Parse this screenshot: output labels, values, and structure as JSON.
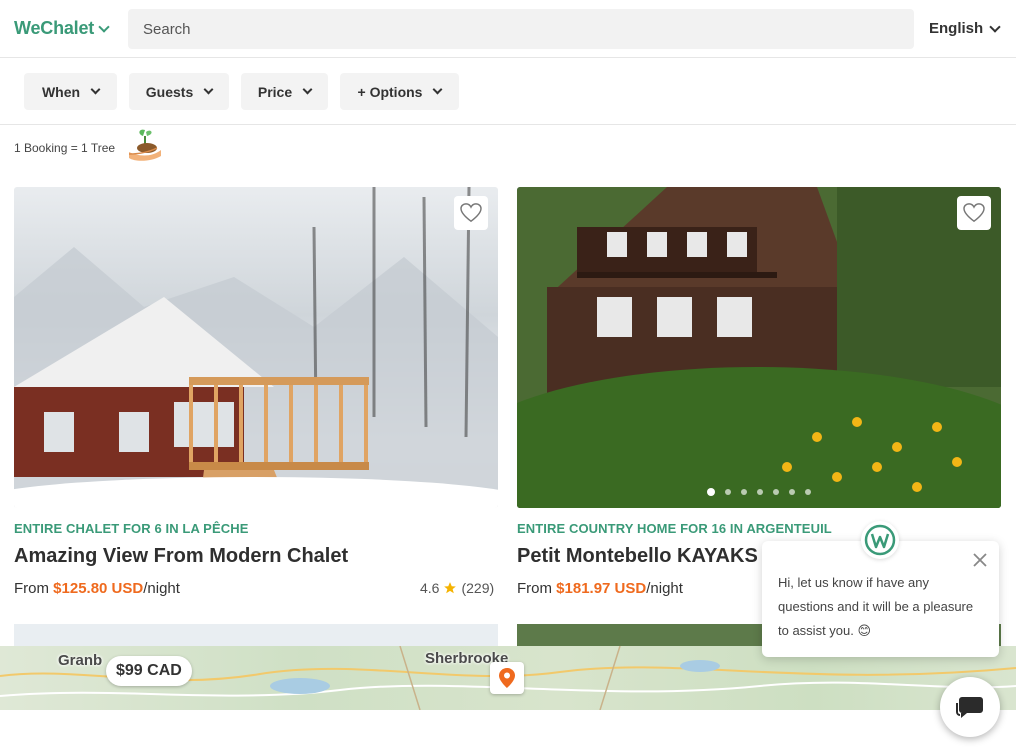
{
  "header": {
    "logo": "WeChalet",
    "search_placeholder": "Search",
    "language": "English"
  },
  "filters": [
    {
      "label": "When"
    },
    {
      "label": "Guests"
    },
    {
      "label": "Price"
    },
    {
      "label": "+ Options"
    }
  ],
  "banner": {
    "text": "1 Booking = 1 Tree"
  },
  "listings": [
    {
      "type": "ENTIRE CHALET FOR 6 IN LA PÊCHE",
      "title": "Amazing View From Modern Chalet",
      "from": "From",
      "price": "$125.80 USD",
      "per": "/night",
      "rating": "4.6",
      "reviews": "(229)",
      "carousel_active": 2,
      "carousel_count": 7
    },
    {
      "type": "ENTIRE COUNTRY HOME FOR 16 IN ARGENTEUIL",
      "title": "Petit Montebello KAYAKS",
      "from": "From",
      "price": "$181.97 USD",
      "per": "/night",
      "carousel_active": 1,
      "carousel_count": 7
    }
  ],
  "map": {
    "cities": [
      "Granb",
      "Sherbrooke"
    ],
    "price_marker": "$99 CAD"
  },
  "chat": {
    "message": "Hi, let us know if have any questions and it will be a pleasure to assist you. 😊"
  },
  "colors": {
    "brand": "#3a9a78",
    "price": "#ef6a1e"
  }
}
